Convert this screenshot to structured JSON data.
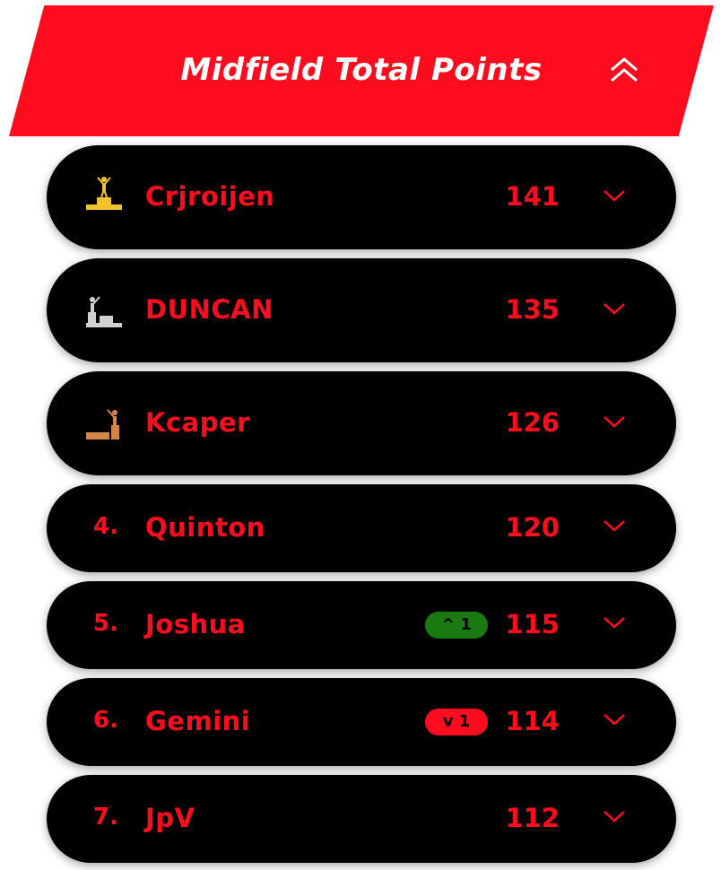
{
  "header": {
    "title": "Midfield Total Points",
    "collapse_icon": "double-chevron-up-icon"
  },
  "colors": {
    "accent": "#ff0d1e",
    "gold": "#f0c32a",
    "silver": "#d0d0d0",
    "bronze": "#d2874a",
    "up": "#1a7a12",
    "down": "#ff0d1e"
  },
  "rows": [
    {
      "rank_icon": "gold-podium-icon",
      "name": "Crjroijen",
      "points": "141"
    },
    {
      "rank_icon": "silver-podium-icon",
      "name": "DUNCAN",
      "points": "135"
    },
    {
      "rank_icon": "bronze-podium-icon",
      "name": "Kcaper",
      "points": "126"
    },
    {
      "rank": "4.",
      "name": "Quinton",
      "points": "120"
    },
    {
      "rank": "5.",
      "name": "Joshua",
      "points": "115",
      "change": "^ 1",
      "change_dir": "up"
    },
    {
      "rank": "6.",
      "name": "Gemini",
      "points": "114",
      "change": "v 1",
      "change_dir": "down"
    },
    {
      "rank": "7.",
      "name": "JpV",
      "points": "112"
    }
  ]
}
